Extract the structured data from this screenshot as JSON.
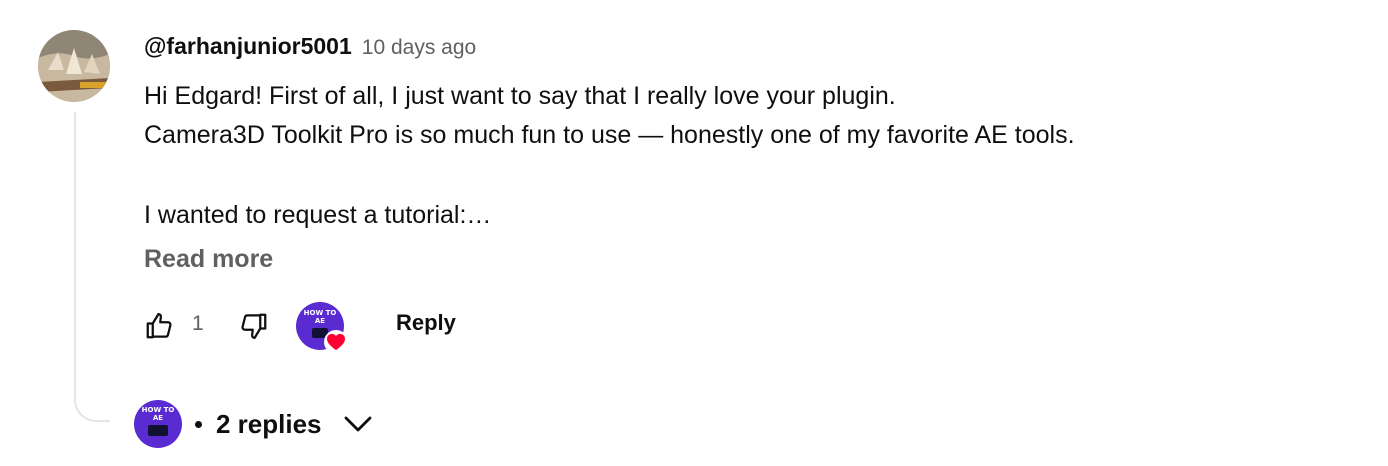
{
  "comment": {
    "author": "@farhanjunior5001",
    "time": "10 days ago",
    "lines": [
      "Hi Edgard! First of all, I just want to say that I really love your plugin.",
      "Camera3D Toolkit Pro is so much fun to use — honestly one of my favorite AE tools.",
      "",
      "I wanted to request a tutorial:…"
    ],
    "read_more": "Read more",
    "like_count": "1",
    "reply_label": "Reply"
  },
  "creator": {
    "logo_line1": "HOW TO",
    "logo_line2": "AE",
    "logo_box": "HowtoAE"
  },
  "replies": {
    "label": "2 replies"
  },
  "colors": {
    "text_primary": "#0f0f0f",
    "text_secondary": "#606060",
    "creator_purple": "#5a2bd0",
    "heart_red": "#ff0033",
    "thread_line": "#e5e5e5"
  },
  "icons": {
    "like": "thumbs-up-icon",
    "dislike": "thumbs-down-icon",
    "heart": "heart-icon",
    "expand": "chevron-down-icon"
  }
}
